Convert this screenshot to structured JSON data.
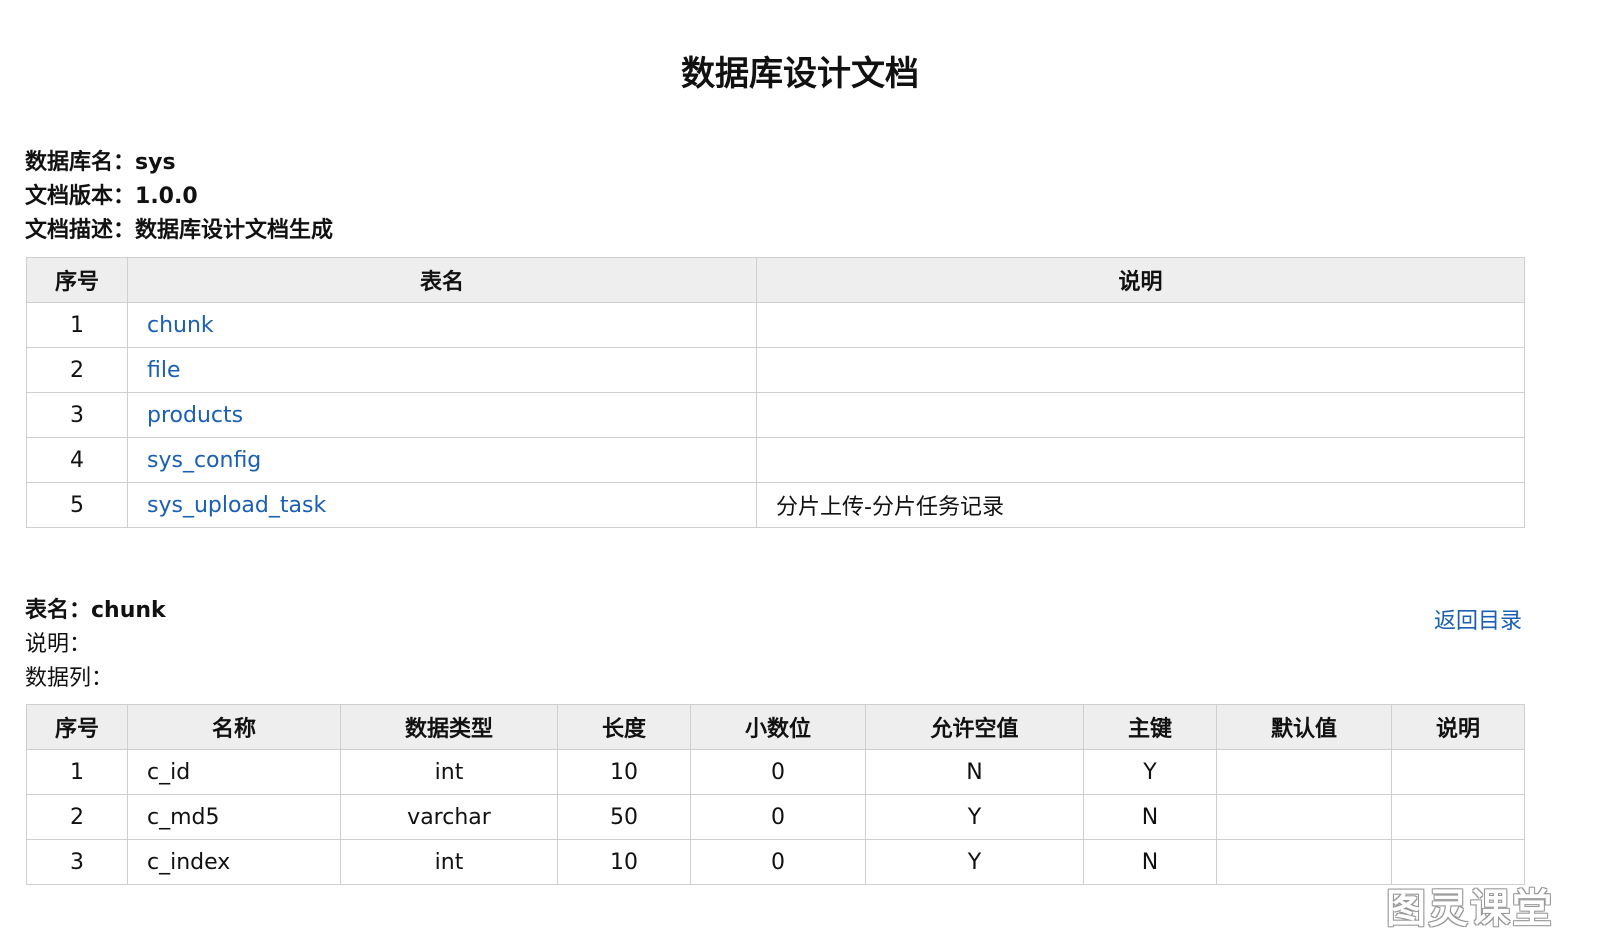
{
  "title": "数据库设计文档",
  "meta": [
    {
      "label": "数据库名：",
      "value": "sys"
    },
    {
      "label": "文档版本：",
      "value": "1.0.0"
    },
    {
      "label": "文档描述：",
      "value": "数据库设计文档生成"
    }
  ],
  "toc": {
    "headers": [
      "序号",
      "表名",
      "说明"
    ],
    "rows": [
      {
        "no": "1",
        "name": "chunk",
        "desc": ""
      },
      {
        "no": "2",
        "name": "file",
        "desc": ""
      },
      {
        "no": "3",
        "name": "products",
        "desc": ""
      },
      {
        "no": "4",
        "name": "sys_config",
        "desc": ""
      },
      {
        "no": "5",
        "name": "sys_upload_task",
        "desc": "分片上传-分片任务记录"
      }
    ]
  },
  "detail": {
    "table_label": "表名：",
    "table_name": "chunk",
    "desc_label": "说明：",
    "desc_value": "",
    "columns_label": "数据列：",
    "back_link": "返回目录",
    "headers": [
      "序号",
      "名称",
      "数据类型",
      "长度",
      "小数位",
      "允许空值",
      "主键",
      "默认值",
      "说明"
    ],
    "rows": [
      [
        "1",
        "c_id",
        "int",
        "10",
        "0",
        "N",
        "Y",
        "",
        ""
      ],
      [
        "2",
        "c_md5",
        "varchar",
        "50",
        "0",
        "Y",
        "N",
        "",
        ""
      ],
      [
        "3",
        "c_index",
        "int",
        "10",
        "0",
        "Y",
        "N",
        "",
        ""
      ]
    ]
  },
  "watermark": "图灵课堂"
}
